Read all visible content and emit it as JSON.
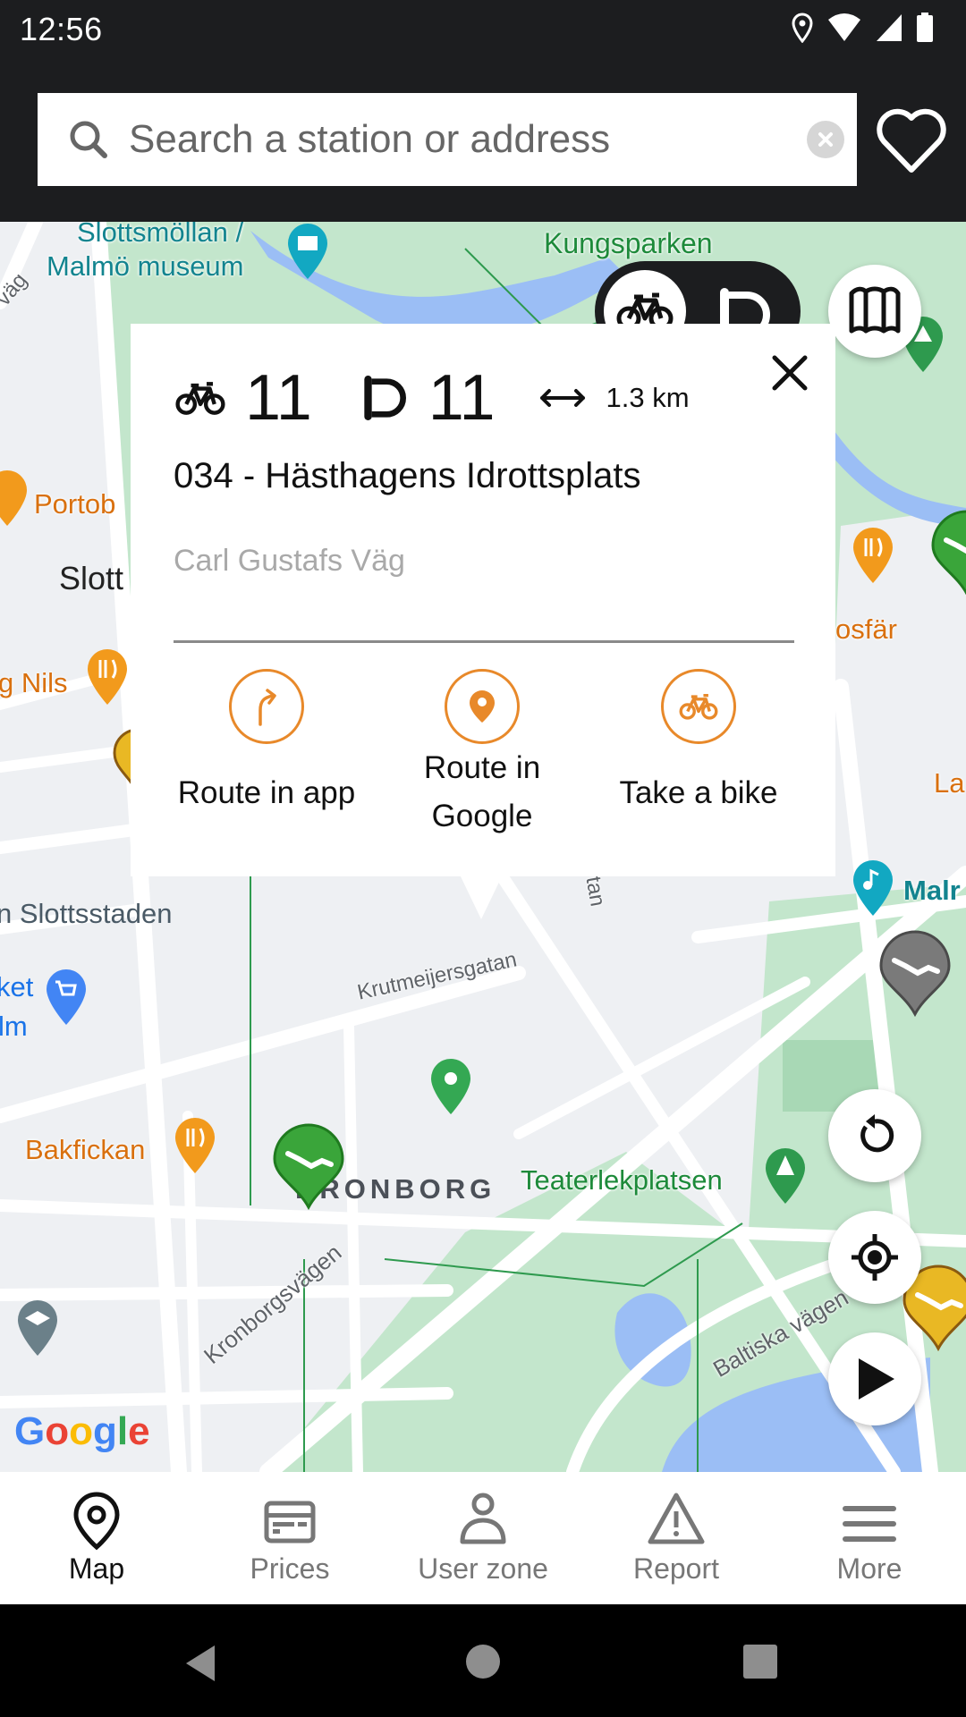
{
  "status_bar": {
    "time": "12:56",
    "icons": [
      "location-icon",
      "wifi-icon",
      "signal-icon",
      "battery-icon"
    ]
  },
  "search": {
    "placeholder": "Search a station or address",
    "value": "",
    "search_icon": "search-icon",
    "clear_icon": "clear-icon"
  },
  "favorites_icon": "heart-icon",
  "map": {
    "labels": {
      "museum": "Slottsmöllan / Malmö museum",
      "museum_line1": "Slottsmöllan /",
      "museum_line2": "Malmö museum",
      "kungsparken": "Kungsparken",
      "vag_partial": "väg",
      "portob": "Portob",
      "slott": "Slott",
      "nils": "g Nils",
      "osfar": "osfär",
      "fersens": "Fersens väg",
      "la": "La",
      "malm_right": "Malr",
      "slottsstaden": "n Slottsstaden",
      "ket": "ket",
      "lm": "lm",
      "krutmeijersgatan": "Krutmeijersgatan",
      "tan": "tan",
      "bakfickan": "Bakfickan",
      "kronborg": "KRONBORG",
      "teaterlekplatsen": "Teaterlekplatsen",
      "kronborgsvagen": "Kronborgsvägen",
      "baltiska": "Baltiska vägen",
      "google": "Google"
    },
    "mode_toggle": {
      "selected": "bikes",
      "options": [
        "bikes",
        "docks"
      ]
    },
    "colors": {
      "park": "#c3e6cc",
      "water": "#9bbef5",
      "road": "#ffffff",
      "land": "#eef0f3",
      "station_green": "#3aa53a",
      "station_gray": "#7a7a7a",
      "station_yellow": "#e9b824"
    }
  },
  "station_card": {
    "bikes_available": "11",
    "docks_available": "11",
    "distance": "1.3 km",
    "name": "034 - Hästhagens Idrottsplats",
    "address": "Carl Gustafs Väg",
    "accent_color": "#e8892a",
    "actions": [
      {
        "label": "Route in app",
        "icon": "turn-right-icon"
      },
      {
        "label": "Route in Google",
        "label_line1": "Route in",
        "label_line2": "Google",
        "icon": "map-pin-icon"
      },
      {
        "label": "Take a bike",
        "icon": "bike-icon"
      }
    ]
  },
  "map_controls": [
    "map-layers-icon",
    "refresh-icon",
    "my-location-icon",
    "play-icon"
  ],
  "bottom_nav": {
    "items": [
      {
        "label": "Map",
        "active": true
      },
      {
        "label": "Prices",
        "active": false
      },
      {
        "label": "User zone",
        "active": false
      },
      {
        "label": "Report",
        "active": false
      },
      {
        "label": "More",
        "active": false
      }
    ]
  }
}
